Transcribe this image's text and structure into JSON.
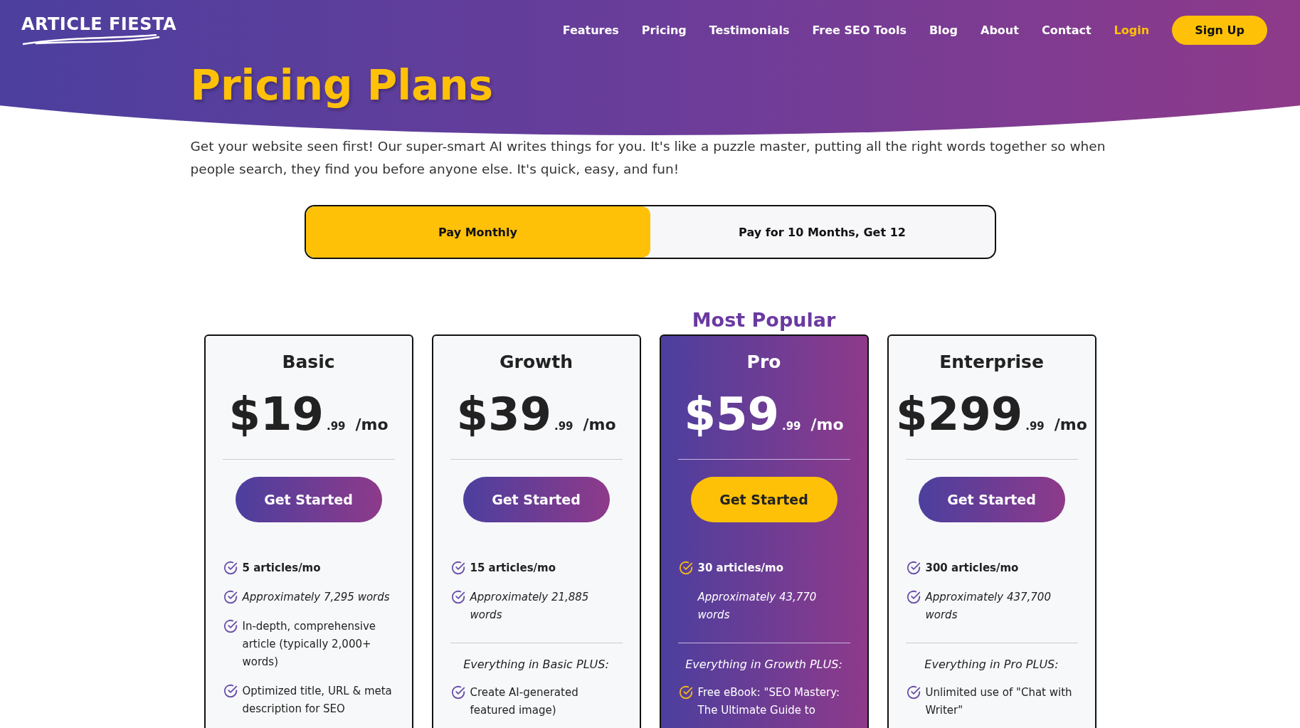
{
  "nav": {
    "logo": "ARTICLE FIESTA",
    "links": [
      {
        "label": "Features",
        "kind": "link"
      },
      {
        "label": "Pricing",
        "kind": "link"
      },
      {
        "label": "Testimonials",
        "kind": "link"
      },
      {
        "label": "Free SEO Tools",
        "kind": "link"
      },
      {
        "label": "Blog",
        "kind": "link"
      },
      {
        "label": "About",
        "kind": "link"
      },
      {
        "label": "Contact",
        "kind": "link"
      },
      {
        "label": "Login",
        "kind": "login"
      }
    ],
    "signup": "Sign Up"
  },
  "title": "Pricing Plans",
  "intro": "Get your website seen first! Our super-smart AI writes things for you. It's like a puzzle master, putting all the right words together so when people search, they find you before anyone else. It's quick, easy, and fun!",
  "billing_tabs": [
    {
      "label": "Pay Monthly",
      "selected": true
    },
    {
      "label": "Pay for 10 Months, Get 12",
      "selected": false
    }
  ],
  "plans": [
    {
      "name": "Basic",
      "featured": false,
      "price": "$19",
      "cents": ".99",
      "period": "/mo",
      "button": "Get Started",
      "features": [
        {
          "text": "5 articles/mo",
          "kind": "count",
          "checked": true
        },
        {
          "text": "Approximately 7,295 words",
          "kind": "words",
          "checked": true
        },
        {
          "text": "In-depth, comprehensive article (typically 2,000+ words)",
          "kind": "plain",
          "checked": true
        },
        {
          "text": "Optimized title, URL & meta description for SEO",
          "kind": "plain",
          "checked": true
        }
      ]
    },
    {
      "name": "Growth",
      "featured": false,
      "price": "$39",
      "cents": ".99",
      "period": "/mo",
      "button": "Get Started",
      "features": [
        {
          "text": "15 articles/mo",
          "kind": "count",
          "checked": true
        },
        {
          "text": "Approximately 21,885 words",
          "kind": "words",
          "checked": true
        }
      ],
      "plus_label": "Everything in Basic PLUS:",
      "plus_features": [
        {
          "text": "Create AI-generated featured image)",
          "kind": "plain",
          "checked": true
        }
      ]
    },
    {
      "name": "Pro",
      "badge": "Most Popular",
      "featured": true,
      "price": "$59",
      "cents": ".99",
      "period": "/mo",
      "button": "Get Started",
      "features": [
        {
          "text": "30 articles/mo",
          "kind": "count",
          "checked": true
        },
        {
          "text": "Approximately 43,770 words",
          "kind": "words",
          "checked": false
        }
      ],
      "plus_label": "Everything in Growth PLUS:",
      "plus_features": [
        {
          "text": "Free eBook: \"SEO Mastery: The Ultimate Guide to",
          "kind": "plain",
          "checked": true
        }
      ]
    },
    {
      "name": "Enterprise",
      "featured": false,
      "price": "$299",
      "cents": ".99",
      "period": "/mo",
      "button": "Get Started",
      "features": [
        {
          "text": "300 articles/mo",
          "kind": "count",
          "checked": true
        },
        {
          "text": "Approximately 437,700 words",
          "kind": "words",
          "checked": true
        }
      ],
      "plus_label": "Everything in Pro PLUS:",
      "plus_features": [
        {
          "text": "Unlimited use of \"Chat with Writer\"",
          "kind": "plain",
          "checked": true
        }
      ]
    }
  ]
}
